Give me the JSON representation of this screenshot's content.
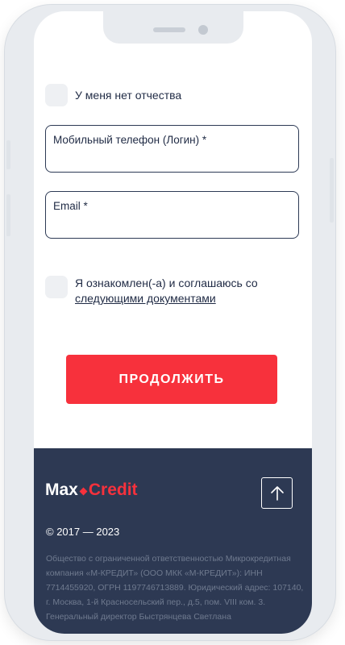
{
  "form": {
    "no_patronymic_label": "У меня нет отчества",
    "phone_label": "Мобильный телефон (Логин) *",
    "email_label": "Email *",
    "consent_text": "Я ознакомлен(-а) и соглашаюсь со ",
    "consent_link": "следующими документами",
    "continue_label": "ПРОДОЛЖИТЬ"
  },
  "footer": {
    "logo_max": "Max",
    "logo_credit": "Credit",
    "scroll_top_icon": "arrow-up-icon",
    "copyright": "© 2017 — 2023",
    "legal_text": "Общество с ограниченной ответственностью Микрокредитная компания «М-КРЕДИТ» (ООО МКК «М-КРЕДИТ»): ИНН 7714455920, ОГРН 1197746713889. Юридический адрес: 107140, г. Москва, 1-й Красносельский пер., д.5, пом. VIII ком. 3. Генеральный директор Быстрянцева Светлана"
  },
  "colors": {
    "accent": "#f7313c",
    "footer_bg": "#2d3953",
    "text": "#1f2a44"
  }
}
